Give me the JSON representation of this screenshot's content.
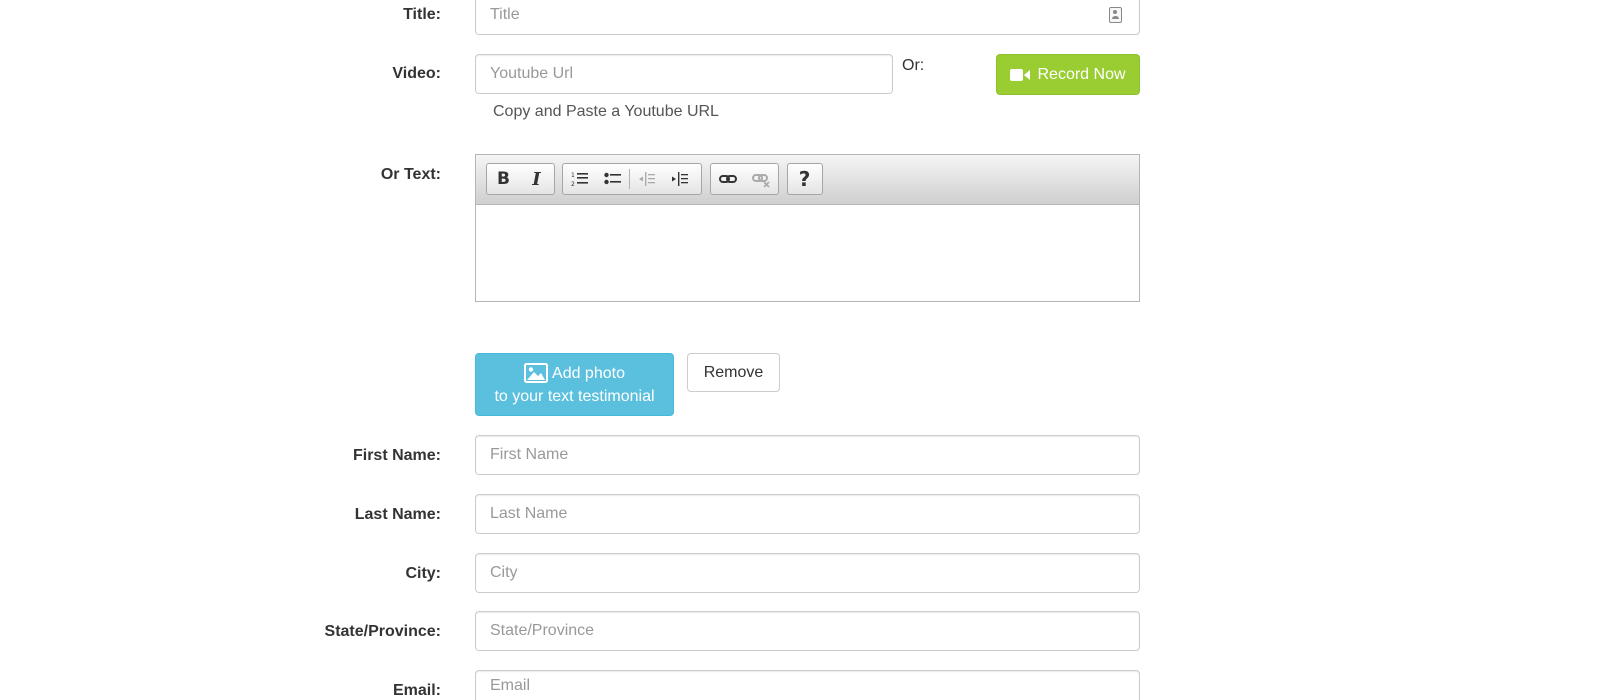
{
  "form": {
    "title": {
      "label": "Title:",
      "placeholder": "Title"
    },
    "video": {
      "label": "Video:",
      "placeholder": "Youtube Url",
      "or_label": "Or:",
      "record_button": "Record Now",
      "help_text": "Copy and Paste a Youtube URL"
    },
    "text": {
      "label": "Or Text:",
      "toolbar": {
        "bold": "B",
        "italic": "I",
        "help": "?"
      }
    },
    "photo": {
      "add_button_line1": "Add photo",
      "add_button_line2": "to your text testimonial",
      "remove_button": "Remove"
    },
    "first_name": {
      "label": "First Name:",
      "placeholder": "First Name"
    },
    "last_name": {
      "label": "Last Name:",
      "placeholder": "Last Name"
    },
    "city": {
      "label": "City:",
      "placeholder": "City"
    },
    "state": {
      "label": "State/Province:",
      "placeholder": "State/Province"
    },
    "email": {
      "label": "Email:",
      "placeholder": "Email"
    }
  },
  "colors": {
    "record_button": "#9acd32",
    "add_photo_button": "#5bc0de",
    "input_border": "#cccccc",
    "placeholder": "#999999"
  },
  "icons": [
    "contact-card-icon",
    "video-camera-icon",
    "image-icon",
    "bold-icon",
    "italic-icon",
    "ordered-list-icon",
    "unordered-list-icon",
    "outdent-icon",
    "indent-icon",
    "link-icon",
    "unlink-icon",
    "help-icon"
  ]
}
